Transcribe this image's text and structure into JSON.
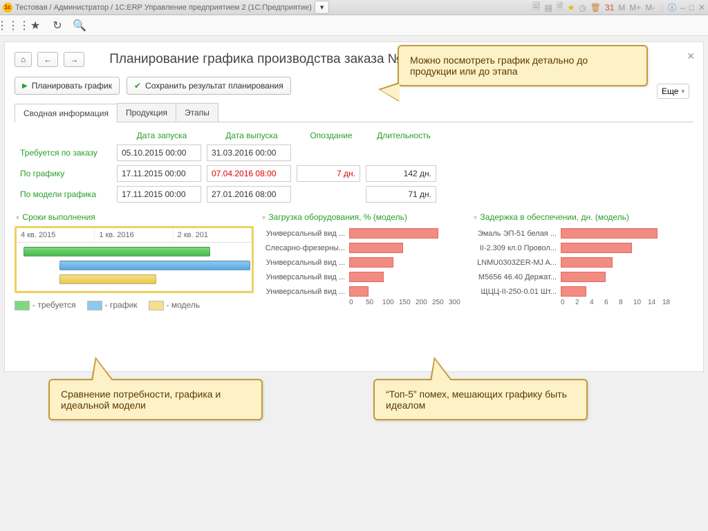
{
  "window_title": "Тестовая / Администратор / 1C:ERP Управление предприятием 2  (1С:Предприятие)",
  "page_title": "Планирование графика производства заказа № 1 от 02.10.2015",
  "buttons": {
    "plan": "Планировать график",
    "save": "Сохранить результат планирования",
    "more": "Еще"
  },
  "tabs": {
    "summary": "Сводная информация",
    "products": "Продукция",
    "stages": "Этапы"
  },
  "cols": {
    "start": "Дата запуска",
    "end": "Дата выпуска",
    "late": "Опоздание",
    "dur": "Длительность"
  },
  "rows": {
    "order": {
      "label": "Требуется по заказу",
      "start": "05.10.2015 00:00",
      "end": "31.03.2016 00:00",
      "late": "",
      "dur": ""
    },
    "sched": {
      "label": "По графику",
      "start": "17.11.2015 00:00",
      "end": "07.04.2016 08:00",
      "late": "7 дн.",
      "dur": "142 дн."
    },
    "model": {
      "label": "По модели графика",
      "start": "17.11.2015 00:00",
      "end": "27.01.2016 08:00",
      "late": "",
      "dur": "71 дн."
    }
  },
  "sec1": {
    "title": "Сроки выполнения",
    "q1": "4 кв. 2015",
    "q2": "1 кв. 2016",
    "q3": "2 кв. 201",
    "leg_req": "- требуется",
    "leg_sch": "- график",
    "leg_mod": "- модель"
  },
  "sec2": {
    "title": "Загрузка оборудования, % (модель)"
  },
  "sec3": {
    "title": "Задержка в обеспечении, дн. (модель)"
  },
  "callouts": {
    "c1": "Можно посмотреть график детально до продукции или до этапа",
    "c2": "Сравнение потребности, графика и идеальной модели",
    "c3": "“Топ-5” помех, мешающих графику быть идеалом"
  },
  "chart_data": [
    {
      "type": "bar",
      "orientation": "horizontal",
      "title": "Загрузка оборудования, % (модель)",
      "xlabel": "",
      "ylabel": "",
      "xlim": [
        0,
        300
      ],
      "ticks": [
        0,
        50,
        100,
        150,
        200,
        250,
        300
      ],
      "categories": [
        "Универсальный вид ...",
        "Слесарно-фрезерны...",
        "Универсальный вид ...",
        "Универсальный вид ...",
        "Универсальный вид ..."
      ],
      "values": [
        230,
        140,
        115,
        90,
        50
      ]
    },
    {
      "type": "bar",
      "orientation": "horizontal",
      "title": "Задержка в обеспечении, дн. (модель)",
      "xlabel": "",
      "ylabel": "",
      "xlim": [
        0,
        18
      ],
      "ticks": [
        0,
        2,
        4,
        6,
        8,
        10,
        14,
        18
      ],
      "categories": [
        "Эмаль ЭП-51 белая ...",
        "II-2.309 кл.0 Провол...",
        "LNMU0303ZER-MJ A...",
        "M5656 46.40 Держат...",
        "ЩЦЦ-II-250-0.01 Шт..."
      ],
      "values": [
        15,
        11,
        8,
        7,
        4
      ]
    }
  ]
}
